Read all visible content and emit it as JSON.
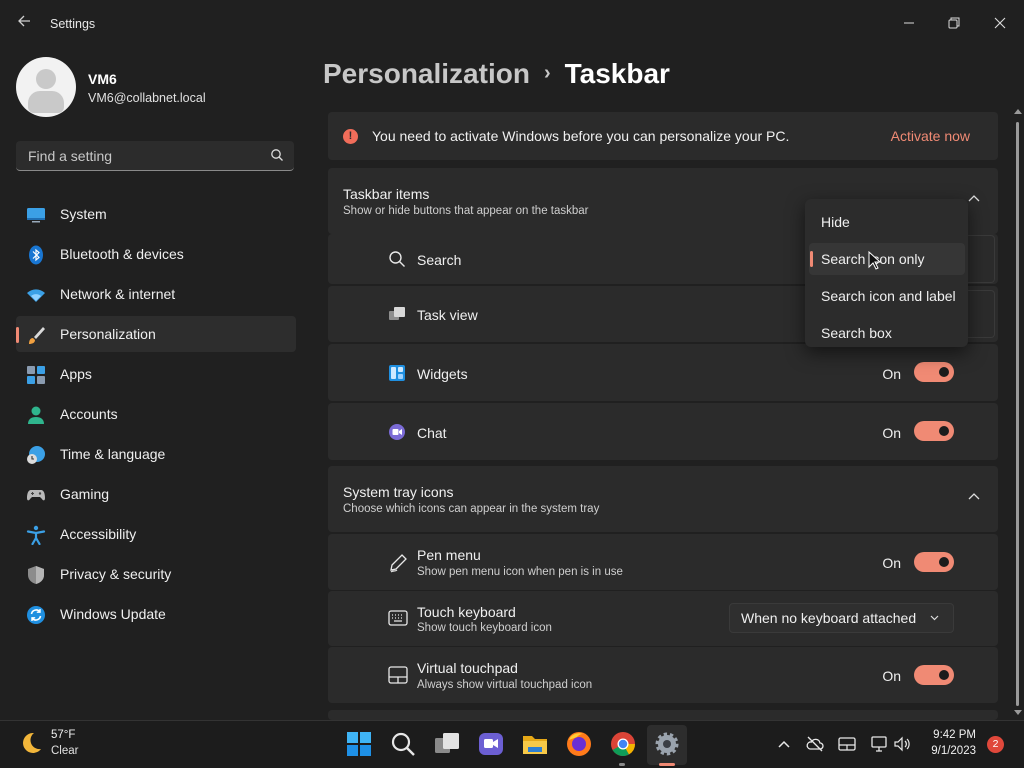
{
  "window": {
    "title": "Settings",
    "back_icon": "arrow-left-icon",
    "controls": [
      "minimize-icon",
      "restore-icon",
      "close-icon"
    ]
  },
  "profile": {
    "name": "VM6",
    "email": "VM6@collabnet.local"
  },
  "search": {
    "placeholder": "Find a setting",
    "icon": "search-icon"
  },
  "nav": {
    "items": [
      {
        "label": "System",
        "icon": "system-icon"
      },
      {
        "label": "Bluetooth & devices",
        "icon": "bluetooth-icon"
      },
      {
        "label": "Network & internet",
        "icon": "wifi-icon"
      },
      {
        "label": "Personalization",
        "icon": "paintbrush-icon",
        "active": true
      },
      {
        "label": "Apps",
        "icon": "apps-icon"
      },
      {
        "label": "Accounts",
        "icon": "accounts-icon"
      },
      {
        "label": "Time & language",
        "icon": "clock-globe-icon"
      },
      {
        "label": "Gaming",
        "icon": "gamepad-icon"
      },
      {
        "label": "Accessibility",
        "icon": "accessibility-icon"
      },
      {
        "label": "Privacy & security",
        "icon": "shield-icon"
      },
      {
        "label": "Windows Update",
        "icon": "update-icon"
      }
    ]
  },
  "breadcrumb": {
    "parent": "Personalization",
    "separator": "›",
    "current": "Taskbar"
  },
  "banner": {
    "message": "You need to activate Windows before you can personalize your PC.",
    "action": "Activate now",
    "accent": "#f08a74",
    "warn_color": "#f16d5a"
  },
  "taskbar_items": {
    "title": "Taskbar items",
    "subtitle": "Show or hide buttons that appear on the taskbar",
    "rows": [
      {
        "label": "Search",
        "icon": "search-icon"
      },
      {
        "label": "Task view",
        "icon": "task-view-icon"
      },
      {
        "label": "Widgets",
        "icon": "widgets-icon",
        "state": "On"
      },
      {
        "label": "Chat",
        "icon": "chat-icon",
        "state": "On"
      }
    ]
  },
  "search_dropdown": {
    "options": [
      "Hide",
      "Search icon only",
      "Search icon and label",
      "Search box"
    ],
    "selected": "Search icon only"
  },
  "system_tray": {
    "title": "System tray icons",
    "subtitle": "Choose which icons can appear in the system tray",
    "rows": [
      {
        "label": "Pen menu",
        "sub": "Show pen menu icon when pen is in use",
        "icon": "pen-icon",
        "state": "On"
      },
      {
        "label": "Touch keyboard",
        "sub": "Show touch keyboard icon",
        "icon": "keyboard-icon",
        "dropdown": "When no keyboard attached"
      },
      {
        "label": "Virtual touchpad",
        "sub": "Always show virtual touchpad icon",
        "icon": "touchpad-icon",
        "state": "On"
      }
    ]
  },
  "taskbar": {
    "weather": {
      "temp": "57°F",
      "condition": "Clear",
      "icon": "moon-icon"
    },
    "apps": [
      "windows-start-icon",
      "search-icon",
      "task-view-icon",
      "chat-icon",
      "file-explorer-icon",
      "firefox-icon",
      "chrome-icon",
      "settings-gear-icon"
    ],
    "tray": [
      "chevron-up-icon",
      "onedrive-icon",
      "keyboard-icon",
      "network-icon",
      "volume-icon"
    ],
    "time": "9:42 PM",
    "date": "9/1/2023",
    "notifications": "2"
  }
}
